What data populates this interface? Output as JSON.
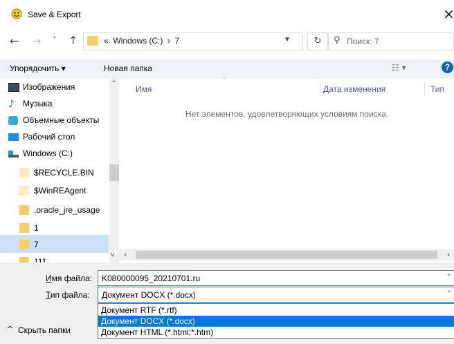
{
  "window": {
    "title": "Save & Export",
    "close_icon": "×"
  },
  "nav": {
    "back": "←",
    "forward": "→",
    "recent": "˅",
    "up": "↑",
    "address": "«  Windows (C:)  ›  7",
    "refresh": "↻",
    "search_placeholder": "Поиск: 7"
  },
  "toolbar": {
    "organize": "Упорядочить ▾",
    "new_folder": "Новая папка",
    "view": "☷ ▾",
    "help": "?"
  },
  "sidebar": {
    "items": [
      {
        "label": "Изображения",
        "icon": "pictures-icon"
      },
      {
        "label": "Музыка",
        "icon": "music-icon"
      },
      {
        "label": "Объемные объекты",
        "icon": "3d-objects-icon"
      },
      {
        "label": "Рабочий стол",
        "icon": "desktop-icon"
      },
      {
        "label": "Windows  (C:)",
        "icon": "drive-icon"
      },
      {
        "label": "$RECYCLE.BIN",
        "icon": "folder-icon"
      },
      {
        "label": "$WinREAgent",
        "icon": "folder-icon"
      },
      {
        "label": ".oracle_jre_usage",
        "icon": "folder-icon"
      },
      {
        "label": "1",
        "icon": "folder-icon"
      },
      {
        "label": "7",
        "icon": "folder-icon",
        "selected": true
      },
      {
        "label": "111",
        "icon": "folder-icon"
      }
    ]
  },
  "columns": {
    "name": "Имя",
    "date": "Дата изменения",
    "type": "Тип"
  },
  "empty_message": "Нет элементов, удовлетворяющих условиям поиска.",
  "form": {
    "filename_label": "Имя файла:",
    "filename_value": "K080000095_20210701.ru",
    "filetype_label": "Тип файла:",
    "filetype_value": "Документ DOCX (*.docx)",
    "filetype_options": [
      "Документ RTF (*.rtf)",
      "Документ DOCX (*.docx)",
      "Документ HTML (*.html;*.htm)"
    ]
  },
  "hide_folders": "Скрыть папки",
  "colors": {
    "accent": "#0078d7",
    "selection": "#cce0f4",
    "folder": "#f3cf6a"
  }
}
